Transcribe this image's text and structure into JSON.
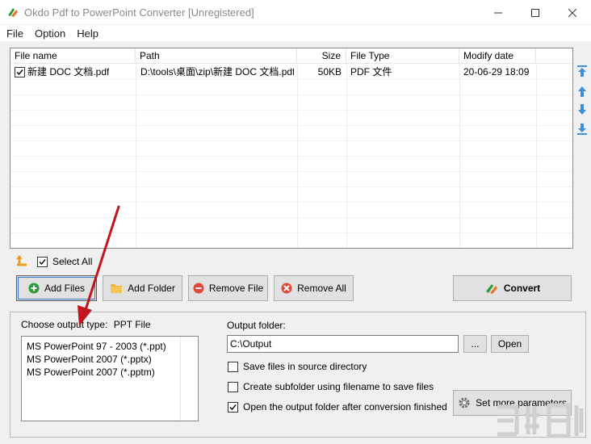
{
  "window": {
    "title": "Okdo Pdf to PowerPoint Converter [Unregistered]"
  },
  "menu": [
    "File",
    "Option",
    "Help"
  ],
  "filelist": {
    "columns": [
      "File name",
      "Path",
      "Size",
      "File Type",
      "Modify date"
    ],
    "rows": [
      {
        "checked": true,
        "name": "新建 DOC 文档.pdf",
        "path": "D:\\tools\\桌面\\zip\\新建 DOC 文档.pdf",
        "size": "50KB",
        "type": "PDF 文件",
        "modified": "20-06-29 18:09"
      }
    ]
  },
  "select_all": {
    "label": "Select All",
    "checked": true
  },
  "buttons": {
    "add_files": "Add Files",
    "add_folder": "Add Folder",
    "remove_file": "Remove File",
    "remove_all": "Remove All",
    "convert": "Convert",
    "browse": "...",
    "open": "Open",
    "set_params": "Set more parameters"
  },
  "output_type": {
    "label": "Choose output type:",
    "selected": "PPT File",
    "options": [
      "MS PowerPoint 97 - 2003 (*.ppt)",
      "MS PowerPoint 2007 (*.pptx)",
      "MS PowerPoint 2007 (*.pptm)"
    ]
  },
  "output_folder": {
    "label": "Output folder:",
    "value": "C:\\Output"
  },
  "options": [
    {
      "label": "Save files in source directory",
      "checked": false
    },
    {
      "label": "Create subfolder using filename to save files",
      "checked": false
    },
    {
      "label": "Open the output folder after conversion finished",
      "checked": true
    }
  ],
  "colors": {
    "arrow_blue": "#3a8fd9",
    "annotation_red": "#c0161e",
    "convert_green": "#2e9b3a",
    "convert_orange": "#e8742c"
  }
}
